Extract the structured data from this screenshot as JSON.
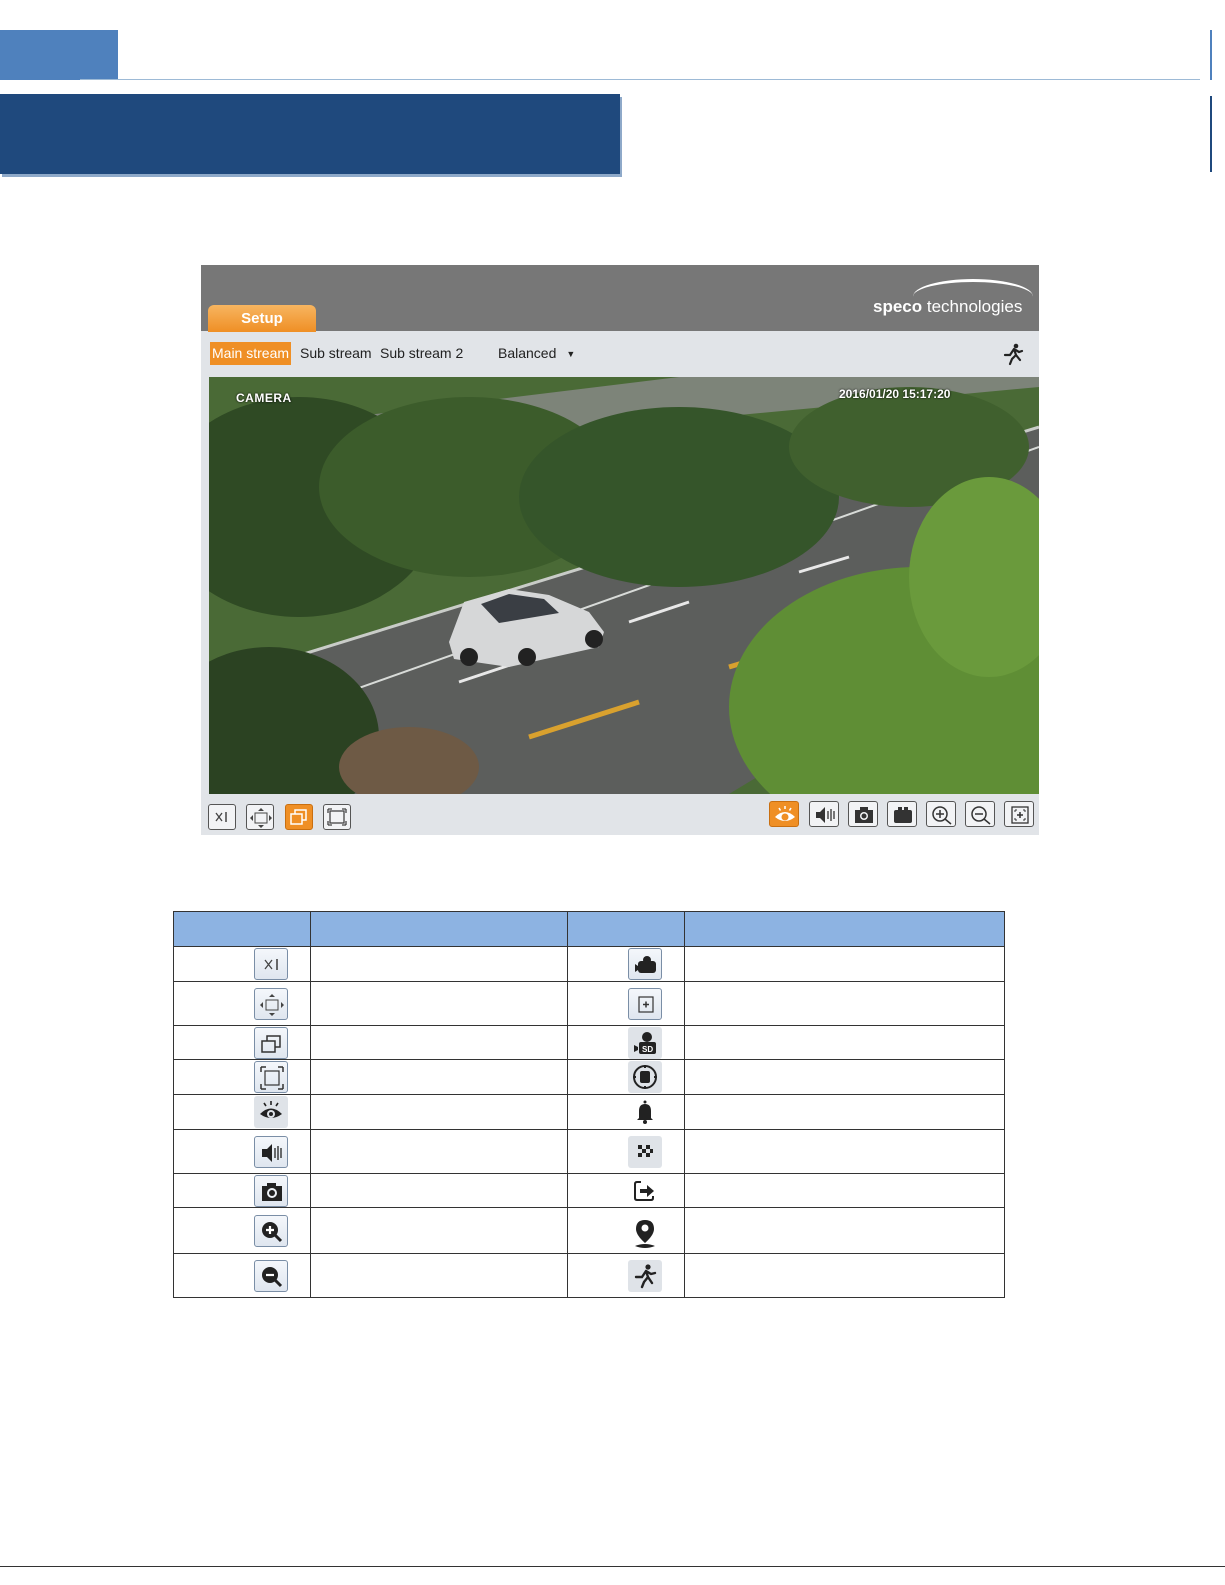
{
  "ui": {
    "setup_tab": "Setup",
    "logo": {
      "word1": "speco",
      "word2": " technologies"
    },
    "streams": [
      "Main stream",
      "Sub stream",
      "Sub stream 2"
    ],
    "quality": "Balanced",
    "video": {
      "label": "CAMERA",
      "timestamp": "2016/01/20  15:17:20"
    }
  },
  "icons": {
    "left_table_icons": [
      "x1-icon",
      "fit-window-icon",
      "restore-window-icon",
      "fullscreen-icon",
      "live-view-icon",
      "audio-icon",
      "snapshot-icon",
      "zoom-in-icon",
      "zoom-out-icon"
    ],
    "right_table_icons": [
      "record-icon",
      "digital-zoom-icon",
      "sd-record-icon",
      "ptz-icon",
      "alarm-bell-icon",
      "mosaic-icon",
      "logout-icon",
      "location-icon",
      "motion-icon"
    ]
  },
  "colors": {
    "accent": "#ef8f25",
    "title_bar": "#1f497d",
    "table_header": "#8db3e2",
    "header_gray": "#777777"
  }
}
